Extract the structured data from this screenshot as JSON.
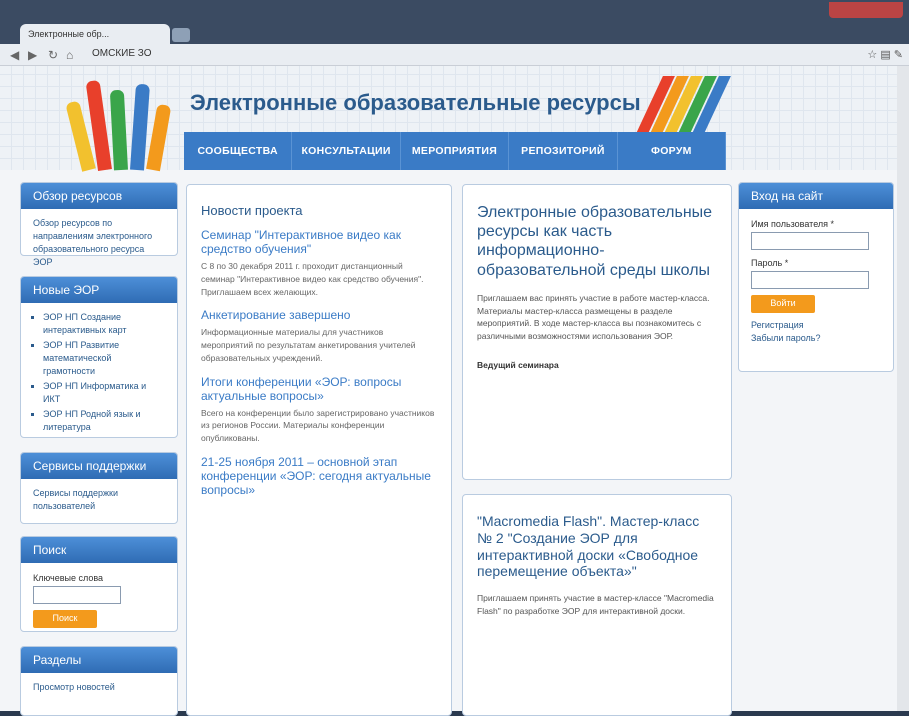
{
  "browser": {
    "tab_title": "Электронные обр...",
    "url": "ОМСКИЕ ЗО"
  },
  "site": {
    "title": "Электронные образовательные ресурсы"
  },
  "menu": [
    "СООБЩЕСТВА",
    "КОНСУЛЬТАЦИИ",
    "МЕРОПРИЯТИЯ",
    "РЕПОЗИТОРИЙ",
    "ФОРУМ"
  ],
  "left": {
    "overview": {
      "title": "Обзор ресурсов",
      "text": "Обзор ресурсов по направлениям электронного образовательного ресурса ЭОР"
    },
    "new": {
      "title": "Новые ЭОР",
      "items": [
        "ЭОР НП Создание интерактивных карт",
        "ЭОР НП Развитие математической грамотности",
        "ЭОР НП Информатика и ИКТ",
        "ЭОР НП Родной язык и литература"
      ]
    },
    "support": {
      "title": "Сервисы поддержки",
      "text": "Сервисы поддержки пользователей"
    },
    "search": {
      "title": "Поиск",
      "label": "Ключевые слова",
      "button": "Поиск"
    },
    "sections": {
      "title": "Разделы",
      "text": "Просмотр новостей"
    }
  },
  "center": {
    "news_heading": "Новости проекта",
    "items": [
      {
        "title": "Семинар \"Интерактивное видео как средство обучения\"",
        "text": "С 8 по 30 декабря 2011 г. проходит дистанционный семинар \"Интерактивное видео как средство обучения\". Приглашаем всех желающих."
      },
      {
        "title": "Анкетирование завершено",
        "text": "Информационные материалы для участников мероприятий по результатам анкетирования учителей образовательных учреждений."
      },
      {
        "title": "Итоги конференции «ЭОР: вопросы актуальные вопросы»",
        "text": "Всего на конференции было зарегистрировано участников из регионов России. Материалы конференции опубликованы."
      },
      {
        "title": "21-25 ноября 2011 – основной этап конференции «ЭОР: сегодня актуальные вопросы»",
        "text": ""
      }
    ]
  },
  "feature": {
    "title": "Электронные образовательные ресурсы как часть информационно-образовательной среды школы",
    "text": "Приглашаем вас принять участие в работе мастер-класса. Материалы мастер-класса размещены в разделе мероприятий. В ходе мастер-класса вы познакомитесь с различными возможностями использования ЭОР.",
    "author": "Ведущий семинара"
  },
  "feature2": {
    "title": "\"Macromedia Flash\". Мастер-класс № 2 \"Создание ЭОР для интерактивной доски «Свободное перемещение объекта»\"",
    "text": "Приглашаем принять участие в мастер-классе \"Macromedia Flash\" по разработке ЭОР для интерактивной доски."
  },
  "login": {
    "title": "Вход на сайт",
    "user_label": "Имя пользователя *",
    "pass_label": "Пароль *",
    "button": "Войти",
    "link1": "Регистрация",
    "link2": "Забыли пароль?"
  }
}
